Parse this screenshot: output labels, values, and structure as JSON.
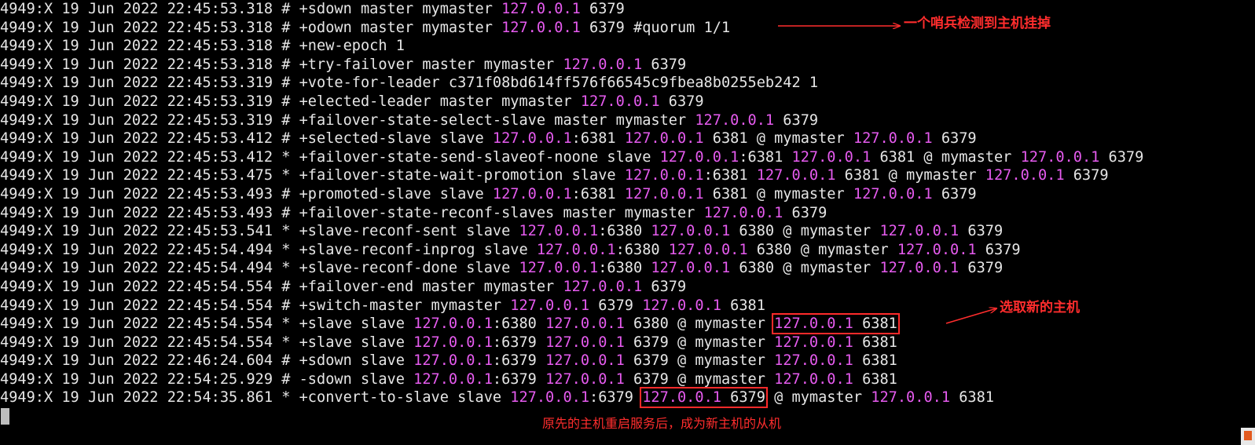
{
  "terminal": {
    "colors": {
      "background": "#000000",
      "text": "#e6e6e6",
      "ip": "#e65bef",
      "annotation": "#ff2d2d"
    },
    "lines": [
      [
        {
          "t": "4949:X 19 Jun 2022 22:45:53.318 # +sdown master mymaster "
        },
        {
          "t": "127.0.0.1",
          "c": "ip"
        },
        {
          "t": " 6379"
        }
      ],
      [
        {
          "t": "4949:X 19 Jun 2022 22:45:53.318 # +odown master mymaster "
        },
        {
          "t": "127.0.0.1",
          "c": "ip"
        },
        {
          "t": " 6379 #quorum 1/1"
        }
      ],
      [
        {
          "t": "4949:X 19 Jun 2022 22:45:53.318 # +new-epoch 1"
        }
      ],
      [
        {
          "t": "4949:X 19 Jun 2022 22:45:53.318 # +try-failover master mymaster "
        },
        {
          "t": "127.0.0.1",
          "c": "ip"
        },
        {
          "t": " 6379"
        }
      ],
      [
        {
          "t": "4949:X 19 Jun 2022 22:45:53.319 # +vote-for-leader c371f08bd614ff576f66545c9fbea8b0255eb242 1"
        }
      ],
      [
        {
          "t": "4949:X 19 Jun 2022 22:45:53.319 # +elected-leader master mymaster "
        },
        {
          "t": "127.0.0.1",
          "c": "ip"
        },
        {
          "t": " 6379"
        }
      ],
      [
        {
          "t": "4949:X 19 Jun 2022 22:45:53.319 # +failover-state-select-slave master mymaster "
        },
        {
          "t": "127.0.0.1",
          "c": "ip"
        },
        {
          "t": " 6379"
        }
      ],
      [
        {
          "t": "4949:X 19 Jun 2022 22:45:53.412 # +selected-slave slave "
        },
        {
          "t": "127.0.0.1",
          "c": "ip"
        },
        {
          "t": ":6381 "
        },
        {
          "t": "127.0.0.1",
          "c": "ip"
        },
        {
          "t": " 6381 @ mymaster "
        },
        {
          "t": "127.0.0.1",
          "c": "ip"
        },
        {
          "t": " 6379"
        }
      ],
      [
        {
          "t": "4949:X 19 Jun 2022 22:45:53.412 * +failover-state-send-slaveof-noone slave "
        },
        {
          "t": "127.0.0.1",
          "c": "ip"
        },
        {
          "t": ":6381 "
        },
        {
          "t": "127.0.0.1",
          "c": "ip"
        },
        {
          "t": " 6381 @ mymaster "
        },
        {
          "t": "127.0.0.1",
          "c": "ip"
        },
        {
          "t": " 6379"
        }
      ],
      [
        {
          "t": "4949:X 19 Jun 2022 22:45:53.475 * +failover-state-wait-promotion slave "
        },
        {
          "t": "127.0.0.1",
          "c": "ip"
        },
        {
          "t": ":6381 "
        },
        {
          "t": "127.0.0.1",
          "c": "ip"
        },
        {
          "t": " 6381 @ mymaster "
        },
        {
          "t": "127.0.0.1",
          "c": "ip"
        },
        {
          "t": " 6379"
        }
      ],
      [
        {
          "t": "4949:X 19 Jun 2022 22:45:53.493 # +promoted-slave slave "
        },
        {
          "t": "127.0.0.1",
          "c": "ip"
        },
        {
          "t": ":6381 "
        },
        {
          "t": "127.0.0.1",
          "c": "ip"
        },
        {
          "t": " 6381 @ mymaster "
        },
        {
          "t": "127.0.0.1",
          "c": "ip"
        },
        {
          "t": " 6379"
        }
      ],
      [
        {
          "t": "4949:X 19 Jun 2022 22:45:53.493 # +failover-state-reconf-slaves master mymaster "
        },
        {
          "t": "127.0.0.1",
          "c": "ip"
        },
        {
          "t": " 6379"
        }
      ],
      [
        {
          "t": "4949:X 19 Jun 2022 22:45:53.541 * +slave-reconf-sent slave "
        },
        {
          "t": "127.0.0.1",
          "c": "ip"
        },
        {
          "t": ":6380 "
        },
        {
          "t": "127.0.0.1",
          "c": "ip"
        },
        {
          "t": " 6380 @ mymaster "
        },
        {
          "t": "127.0.0.1",
          "c": "ip"
        },
        {
          "t": " 6379"
        }
      ],
      [
        {
          "t": "4949:X 19 Jun 2022 22:45:54.494 * +slave-reconf-inprog slave "
        },
        {
          "t": "127.0.0.1",
          "c": "ip"
        },
        {
          "t": ":6380 "
        },
        {
          "t": "127.0.0.1",
          "c": "ip"
        },
        {
          "t": " 6380 @ mymaster "
        },
        {
          "t": "127.0.0.1",
          "c": "ip"
        },
        {
          "t": " 6379"
        }
      ],
      [
        {
          "t": "4949:X 19 Jun 2022 22:45:54.494 * +slave-reconf-done slave "
        },
        {
          "t": "127.0.0.1",
          "c": "ip"
        },
        {
          "t": ":6380 "
        },
        {
          "t": "127.0.0.1",
          "c": "ip"
        },
        {
          "t": " 6380 @ mymaster "
        },
        {
          "t": "127.0.0.1",
          "c": "ip"
        },
        {
          "t": " 6379"
        }
      ],
      [
        {
          "t": "4949:X 19 Jun 2022 22:45:54.554 # +failover-end master mymaster "
        },
        {
          "t": "127.0.0.1",
          "c": "ip"
        },
        {
          "t": " 6379"
        }
      ],
      [
        {
          "t": "4949:X 19 Jun 2022 22:45:54.554 # +switch-master mymaster "
        },
        {
          "t": "127.0.0.1",
          "c": "ip"
        },
        {
          "t": " 6379 "
        },
        {
          "t": "127.0.0.1",
          "c": "ip"
        },
        {
          "t": " 6381"
        }
      ],
      [
        {
          "t": "4949:X 19 Jun 2022 22:45:54.554 * +slave slave "
        },
        {
          "t": "127.0.0.1",
          "c": "ip"
        },
        {
          "t": ":6380 "
        },
        {
          "t": "127.0.0.1",
          "c": "ip"
        },
        {
          "t": " 6380 @ mymaster "
        },
        {
          "t": "127.0.0.1",
          "c": "ip",
          "box": "start"
        },
        {
          "t": " 6381",
          "box": "end"
        }
      ],
      [
        {
          "t": "4949:X 19 Jun 2022 22:45:54.554 * +slave slave "
        },
        {
          "t": "127.0.0.1",
          "c": "ip"
        },
        {
          "t": ":6379 "
        },
        {
          "t": "127.0.0.1",
          "c": "ip"
        },
        {
          "t": " 6379 @ mymaster "
        },
        {
          "t": "127.0.0.1",
          "c": "ip"
        },
        {
          "t": " 6381"
        }
      ],
      [
        {
          "t": "4949:X 19 Jun 2022 22:46:24.604 # +sdown slave "
        },
        {
          "t": "127.0.0.1",
          "c": "ip"
        },
        {
          "t": ":6379 "
        },
        {
          "t": "127.0.0.1",
          "c": "ip"
        },
        {
          "t": " 6379 @ mymaster "
        },
        {
          "t": "127.0.0.1",
          "c": "ip"
        },
        {
          "t": " 6381"
        }
      ],
      [
        {
          "t": "4949:X 19 Jun 2022 22:54:25.929 # -sdown slave "
        },
        {
          "t": "127.0.0.1",
          "c": "ip"
        },
        {
          "t": ":6379 "
        },
        {
          "t": "127.0.0.1",
          "c": "ip"
        },
        {
          "t": " 6379 @ mymaster "
        },
        {
          "t": "127.0.0.1",
          "c": "ip"
        },
        {
          "t": " 6381"
        }
      ],
      [
        {
          "t": "4949:X 19 Jun 2022 22:54:35.861 * +convert-to-slave slave "
        },
        {
          "t": "127.0.0.1",
          "c": "ip"
        },
        {
          "t": ":6379 "
        },
        {
          "t": "127.0.0.1",
          "c": "ip",
          "box": "start"
        },
        {
          "t": " 6379",
          "box": "end"
        },
        {
          "t": " @ mymaster "
        },
        {
          "t": "127.0.0.1",
          "c": "ip"
        },
        {
          "t": " 6381"
        }
      ]
    ]
  },
  "annotations": {
    "sentinel_detected": "一个哨兵检测到主机挂掉",
    "new_master_selected": "选取新的主机",
    "old_master_rejoined": "原先的主机重启服务后，成为新主机的从机"
  }
}
